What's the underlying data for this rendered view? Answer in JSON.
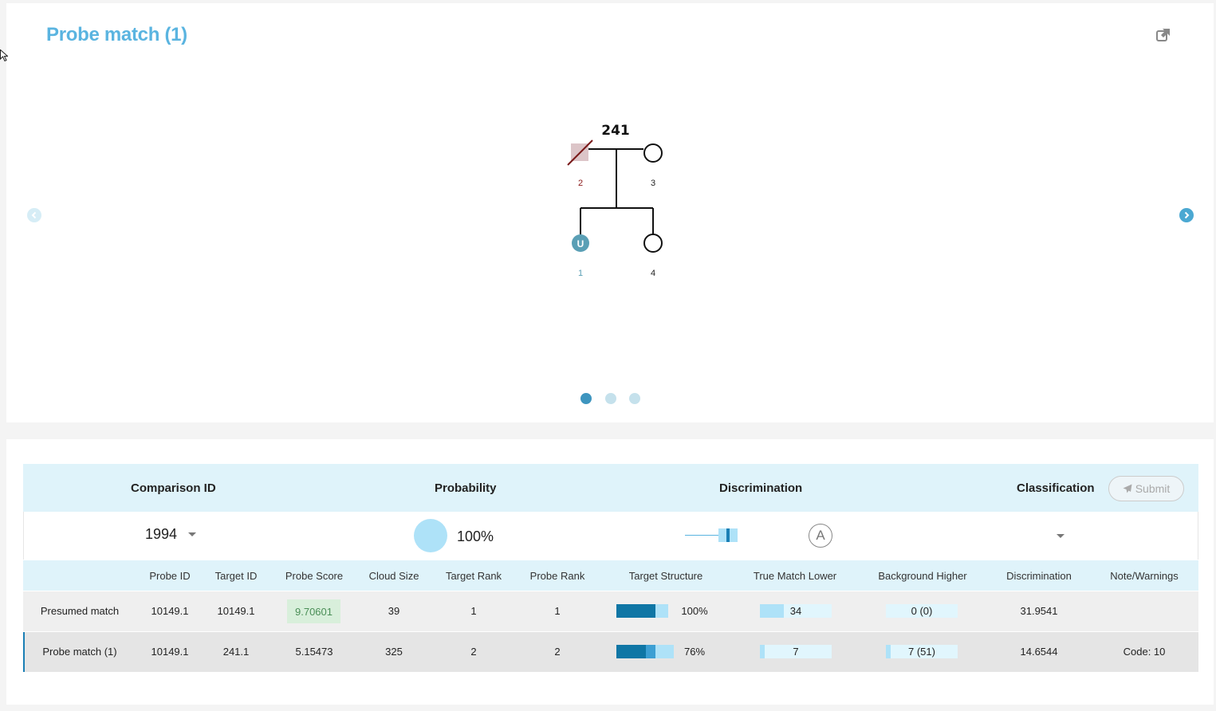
{
  "panel": {
    "title": "Probe match (1)"
  },
  "pedigree": {
    "family_id": "241",
    "members": [
      {
        "id": "2",
        "label_color": "#8b1a1a"
      },
      {
        "id": "3",
        "label_color": "#222222"
      },
      {
        "id": "U",
        "label": "1",
        "label_color": "#5a9fb5"
      },
      {
        "id": "4",
        "label_color": "#222222"
      }
    ]
  },
  "carousel": {
    "slides": 3,
    "active": 1
  },
  "header": {
    "comparison_id_label": "Comparison ID",
    "probability_label": "Probability",
    "discrimination_label": "Discrimination",
    "classification_label": "Classification",
    "submit_label": "Submit"
  },
  "values": {
    "comparison_id": "1994",
    "probability": "100%",
    "grade": "A",
    "classification": ""
  },
  "table": {
    "columns": [
      "Probe ID",
      "Target ID",
      "Probe Score",
      "Cloud Size",
      "Target Rank",
      "Probe Rank",
      "Target Structure",
      "True Match Lower",
      "Background Higher",
      "Discrimination",
      "Note/Warnings"
    ],
    "rows": [
      {
        "name": "Presumed match",
        "probe_id": "10149.1",
        "target_id": "10149.1",
        "probe_score": "9.70601",
        "cloud_size": "39",
        "target_rank": "1",
        "probe_rank": "1",
        "target_structure": "100%",
        "target_structure_fraction": 1.0,
        "true_match_lower": "34",
        "true_match_lower_fraction": 0.33,
        "background_higher": "0 (0)",
        "background_higher_fraction": 0.0,
        "discrimination": "31.9541",
        "note": ""
      },
      {
        "name": "Probe match (1)",
        "probe_id": "10149.1",
        "target_id": "241.1",
        "probe_score": "5.15473",
        "cloud_size": "325",
        "target_rank": "2",
        "probe_rank": "2",
        "target_structure": "76%",
        "target_structure_fraction": 0.76,
        "true_match_lower": "7",
        "true_match_lower_fraction": 0.07,
        "background_higher": "7 (51)",
        "background_higher_fraction": 0.07,
        "discrimination": "14.6544",
        "note": "Code: 10"
      }
    ]
  },
  "colors": {
    "accent": "#5ab4e0",
    "header_bg": "#dff3fa",
    "bar_dark": "#0f76a5",
    "bar_light": "#aee2f8",
    "score_good_bg": "#d8efdb",
    "score_good_text": "#4a8e57"
  },
  "icons": [
    "popout-icon",
    "chevron-left-icon",
    "chevron-right-icon",
    "paper-plane-icon",
    "chevron-down-icon"
  ]
}
